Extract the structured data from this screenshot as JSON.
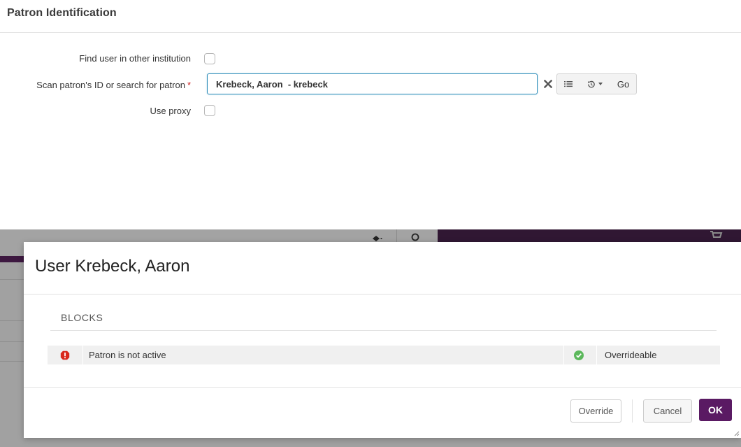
{
  "patron_identification": {
    "title": "Patron Identification",
    "find_in_other_institution": {
      "label": "Find user in other institution",
      "checked": false
    },
    "scan_field": {
      "label": "Scan patron's ID or search for patron",
      "required_marker": "*",
      "value": "Krebeck, Aaron  - krebeck"
    },
    "use_proxy": {
      "label": "Use proxy",
      "checked": false
    },
    "addons": {
      "clear_icon": "x-icon",
      "list_icon": "list-icon",
      "history_icon": "history-icon",
      "go_label": "Go"
    }
  },
  "modal": {
    "title": "User Krebeck, Aaron",
    "blocks_heading": "BLOCKS",
    "blocks": [
      {
        "status_icon": "warning-icon",
        "description": "Patron is not active",
        "override_icon": "check-circle-icon",
        "override_status": "Overrideable"
      }
    ],
    "buttons": {
      "override": "Override",
      "cancel": "Cancel",
      "ok": "OK"
    }
  },
  "colors": {
    "brand_purple": "#5a1a63",
    "input_focus": "#2a8bb8",
    "warning_red": "#d9291c",
    "success_green": "#5cb85c",
    "required_red": "#cc1f1f"
  }
}
